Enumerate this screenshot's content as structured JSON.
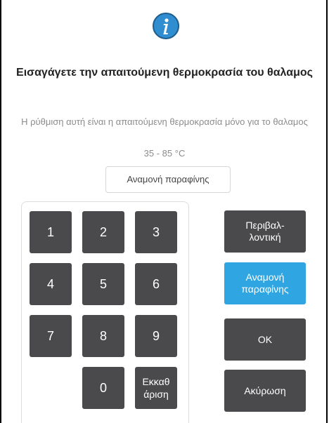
{
  "dialog": {
    "icon": "info-icon",
    "title": "Εισαγάγετε την απαιτούμενη θερμοκρασία του θαλαμος",
    "subtitle": "Η ρύθμιση αυτή είναι η απαιτούμενη θερμοκρασία μόνο για το θαλαμος",
    "range": "35 - 85 °C",
    "value": "Αναμονή παραφίνης"
  },
  "keypad": {
    "k1": "1",
    "k2": "2",
    "k3": "3",
    "k4": "4",
    "k5": "5",
    "k6": "6",
    "k7": "7",
    "k8": "8",
    "k9": "9",
    "k0": "0",
    "clear_line1": "Εκκαθ",
    "clear_line2": "άριση"
  },
  "actions": {
    "ambient_line1": "Περιβαλ-",
    "ambient_line2": "λοντική",
    "paraffin_line1": "Αναμονή",
    "paraffin_line2": "παραφίνης",
    "ok": "OK",
    "cancel": "Ακύρωση"
  },
  "colors": {
    "key_bg": "#4a4a4c",
    "accent": "#2fa6e2",
    "info": "#2f8dd0"
  }
}
